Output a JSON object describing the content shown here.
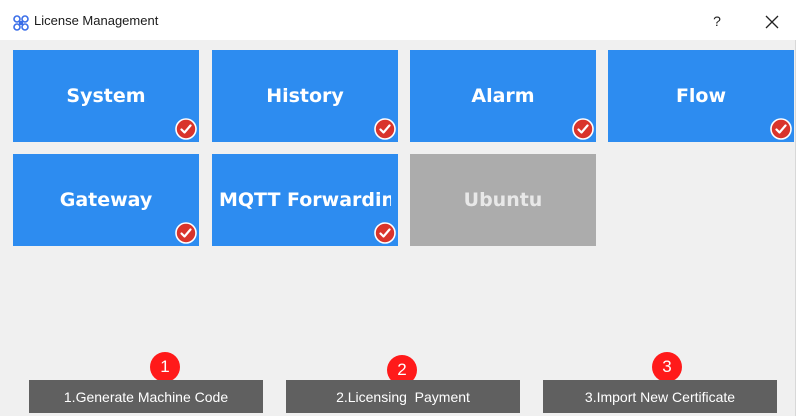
{
  "window": {
    "title": "License Management",
    "app_icon": "cloverleaf-icon",
    "help_label": "?",
    "close_icon": "close-icon"
  },
  "tiles": [
    {
      "label": "System",
      "licensed": true,
      "enabled": true
    },
    {
      "label": "History",
      "licensed": true,
      "enabled": true
    },
    {
      "label": "Alarm",
      "licensed": true,
      "enabled": true
    },
    {
      "label": "Flow",
      "licensed": true,
      "enabled": true
    },
    {
      "label": "Gateway",
      "licensed": true,
      "enabled": true
    },
    {
      "label": "MQTT Forwarding",
      "licensed": true,
      "enabled": true
    },
    {
      "label": "Ubuntu",
      "licensed": false,
      "enabled": false
    }
  ],
  "actions": [
    {
      "step": "1",
      "label": "1.Generate Machine Code"
    },
    {
      "step": "2",
      "label": "2.Licensing  Payment"
    },
    {
      "step": "3",
      "label": "3.Import New Certificate"
    }
  ],
  "colors": {
    "tile_active": "#2d8cf0",
    "tile_disabled": "#acacac",
    "check_badge": "#d9342b",
    "step_badge": "#ff1a1a",
    "action_button": "#606060"
  }
}
